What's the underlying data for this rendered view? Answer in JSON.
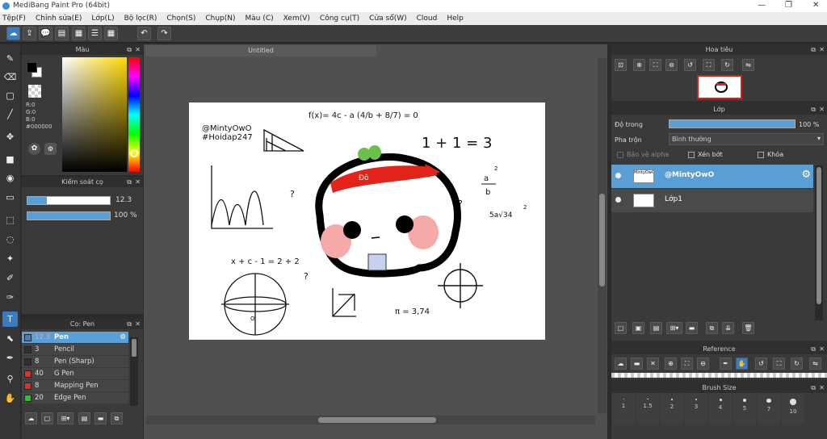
{
  "window": {
    "title": "MediBang Paint Pro (64bit)",
    "min": "—",
    "restore": "❐",
    "close": "✕"
  },
  "menu": [
    "Tệp(F)",
    "Chỉnh sửa(E)",
    "Lớp(L)",
    "Bộ lọc(R)",
    "Chọn(S)",
    "Chụp(N)",
    "Màu (C)",
    "Xem(V)",
    "Công cụ(T)",
    "Cửa sổ(W)",
    "Cloud",
    "Help"
  ],
  "color_panel": {
    "title": "Màu",
    "r": "R:0",
    "g": "G:0",
    "b": "B:0",
    "hex": "#000000"
  },
  "brush_control": {
    "title": "Kiểm soát cọ",
    "size": "12.3",
    "size_fraction": 0.24,
    "opacity": "100 %",
    "opacity_fraction": 1.0
  },
  "brush_panel": {
    "title": "Cọ: Pen",
    "items": [
      {
        "size": "12.3",
        "name": "Pen",
        "color": "#4a7fb5",
        "selected": true
      },
      {
        "size": "3",
        "name": "Pencil",
        "color": "#303030"
      },
      {
        "size": "8",
        "name": "Pen (Sharp)",
        "color": "#303030"
      },
      {
        "size": "40",
        "name": "G Pen",
        "color": "#e03030"
      },
      {
        "size": "8",
        "name": "Mapping Pen",
        "color": "#e03030"
      },
      {
        "size": "20",
        "name": "Edge Pen",
        "color": "#30c030"
      }
    ]
  },
  "canvas": {
    "doc_title": "Untitled"
  },
  "drawing": {
    "user": "@MintyOwO",
    "tag": "#Hoidap247",
    "formula": "f(x)= 4c - a (4/b + 8/7) = 0",
    "eq": "1 + 1 = 3",
    "frac_num": "a",
    "frac_exp": "2",
    "frac_den": "b",
    "sqrt": "5a√34",
    "sqrt_exp": "2",
    "xeq": "x + c - 1 = 2 + 2",
    "pi": "π = 3,74",
    "q": "?",
    "headband": "Đô",
    "sphere_label": "O"
  },
  "navigator": {
    "title": "Hoa tiêu"
  },
  "layer_panel": {
    "title": "Lớp",
    "opacity_label": "Độ trong",
    "opacity_value": "100 %",
    "opacity_fraction": 1.0,
    "blend_label": "Pha trộn",
    "blend_value": "Bình thường",
    "protect_alpha": "Bảo vệ alpha",
    "clipping": "Xén bớt",
    "lock": "Khóa",
    "layers": [
      {
        "name": "@MintyOwO",
        "selected": true,
        "thumb": "MintyOwO"
      },
      {
        "name": "Lớp1",
        "selected": false,
        "thumb": ""
      }
    ]
  },
  "reference": {
    "title": "Reference"
  },
  "brush_size": {
    "title": "Brush Size",
    "sizes": [
      "1",
      "1.5",
      "2",
      "3",
      "4",
      "5",
      "7",
      "10"
    ]
  }
}
